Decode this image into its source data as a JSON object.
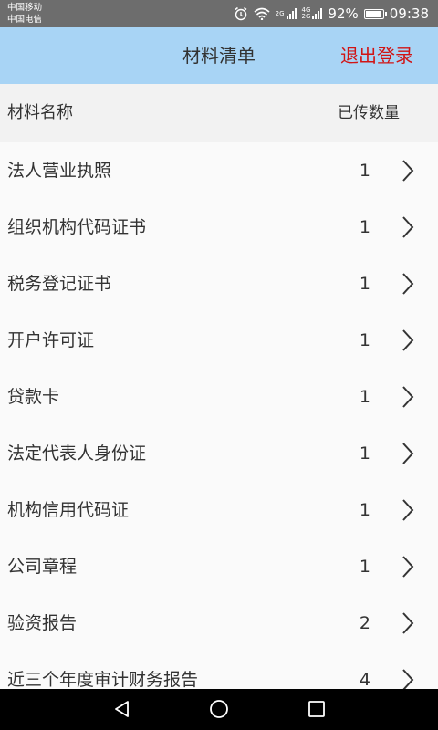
{
  "status_bar": {
    "carrier1": "中国移动",
    "carrier2": "中国电信",
    "net1": "2G",
    "net2_top": "4G",
    "net2_bottom": "2G",
    "battery": "92%",
    "time": "09:38"
  },
  "header": {
    "title": "材料清单",
    "logout": "退出登录"
  },
  "columns": {
    "name": "材料名称",
    "count": "已传数量"
  },
  "items": [
    {
      "name": "法人营业执照",
      "count": "1"
    },
    {
      "name": "组织机构代码证书",
      "count": "1"
    },
    {
      "name": "税务登记证书",
      "count": "1"
    },
    {
      "name": "开户许可证",
      "count": "1"
    },
    {
      "name": "贷款卡",
      "count": "1"
    },
    {
      "name": "法定代表人身份证",
      "count": "1"
    },
    {
      "name": "机构信用代码证",
      "count": "1"
    },
    {
      "name": "公司章程",
      "count": "1"
    },
    {
      "name": "验资报告",
      "count": "2"
    },
    {
      "name": "近三个年度审计财务报告",
      "count": "4"
    }
  ],
  "colors": {
    "header_bg": "#a8d4f5",
    "logout": "#d11414",
    "status_bar_bg": "#6d6d6d"
  },
  "icons": [
    "alarm-icon",
    "wifi-icon",
    "signal-icon",
    "battery-icon",
    "chevron-right-icon",
    "back-icon",
    "home-icon",
    "recents-icon"
  ]
}
